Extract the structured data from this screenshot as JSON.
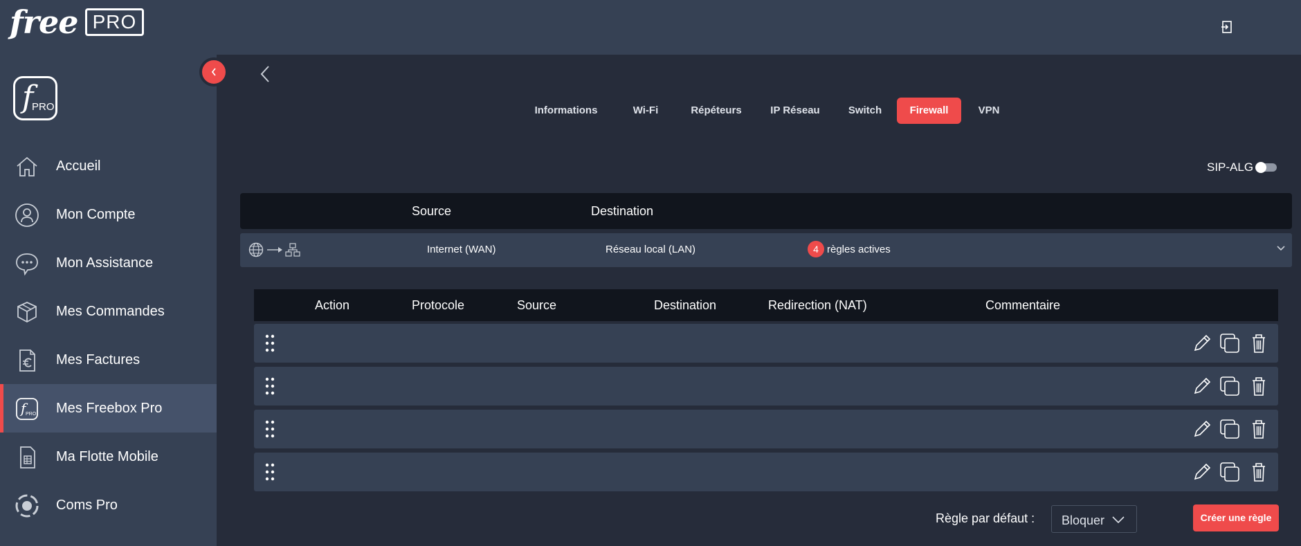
{
  "header": {
    "logo_free": "free",
    "logo_pro": "PRO"
  },
  "sidebar": {
    "logo_f": "f",
    "logo_pro": "PRO",
    "items": [
      {
        "label": "Accueil",
        "icon": "home-icon"
      },
      {
        "label": "Mon Compte",
        "icon": "user-icon"
      },
      {
        "label": "Mon Assistance",
        "icon": "chat-icon"
      },
      {
        "label": "Mes Commandes",
        "icon": "package-icon"
      },
      {
        "label": "Mes Factures",
        "icon": "invoice-euro-icon"
      },
      {
        "label": "Mes Freebox Pro",
        "icon": "freebox-pro-icon",
        "active": true
      },
      {
        "label": "Ma Flotte Mobile",
        "icon": "sim-card-icon"
      },
      {
        "label": "Coms Pro",
        "icon": "coms-icon"
      }
    ]
  },
  "tabs": [
    {
      "label": "Informations"
    },
    {
      "label": "Wi-Fi"
    },
    {
      "label": "Répéteurs"
    },
    {
      "label": "IP Réseau"
    },
    {
      "label": "Switch"
    },
    {
      "label": "Firewall",
      "active": true
    },
    {
      "label": "VPN"
    }
  ],
  "sip_alg": {
    "label": "SIP-ALG",
    "enabled": false
  },
  "rules_table": {
    "headers": {
      "source": "Source",
      "destination": "Destination"
    },
    "row": {
      "source": "Internet (WAN)",
      "destination": "Réseau local (LAN)",
      "count": "4",
      "count_label": "règles actives"
    }
  },
  "sub_table": {
    "headers": [
      "Action",
      "Protocole",
      "Source",
      "Destination",
      "Redirection (NAT)",
      "Commentaire"
    ],
    "rows": 4
  },
  "footer": {
    "default_rule_label": "Règle par défaut :",
    "default_rule_value": "Bloquer",
    "create_button": "Créer une règle"
  },
  "colors": {
    "accent": "#ef4b4b",
    "panel": "#364154",
    "background": "#262c3a",
    "header_dark": "#11151d"
  }
}
